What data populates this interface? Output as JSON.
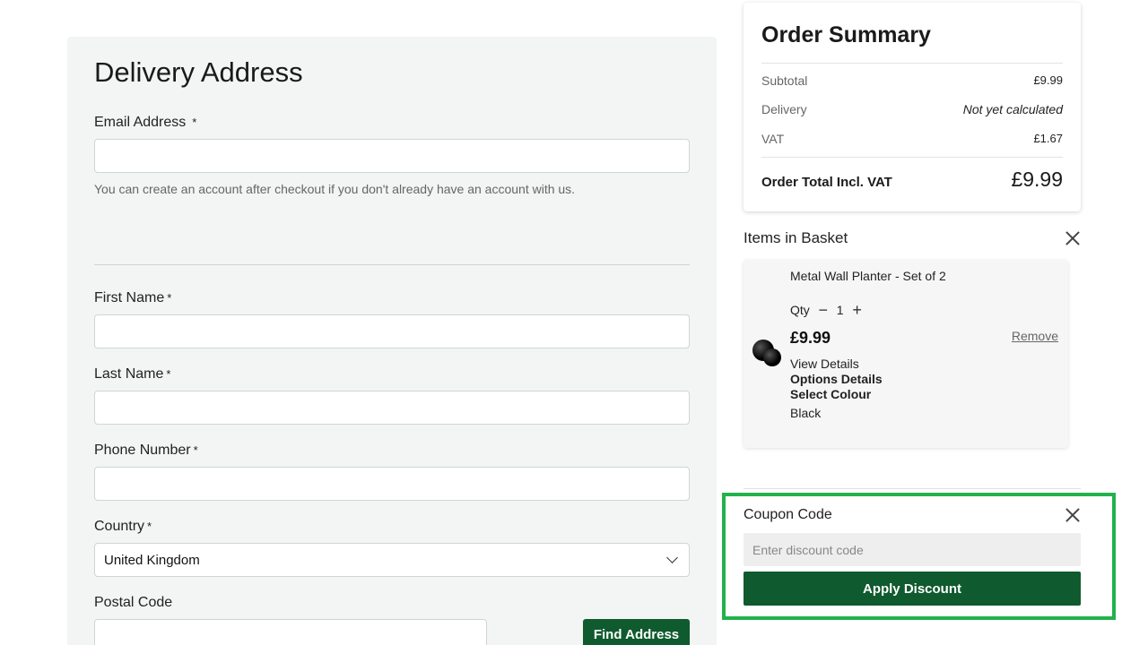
{
  "delivery": {
    "title": "Delivery Address",
    "required_marker": "*",
    "email_label": "Email Address",
    "email_value": "",
    "email_help": "You can create an account after checkout if you don't already have an account with us.",
    "first_name_label": "First Name",
    "last_name_label": "Last Name",
    "phone_label": "Phone Number",
    "country_label": "Country",
    "country_value": "United Kingdom",
    "postal_label": "Postal Code",
    "find_address_label": "Find Address"
  },
  "summary": {
    "title": "Order Summary",
    "rows": [
      {
        "label": "Subtotal",
        "value": "£9.99"
      },
      {
        "label": "Delivery",
        "value": "Not yet calculated"
      },
      {
        "label": "VAT",
        "value": "£1.67"
      }
    ],
    "total_label": "Order Total Incl. VAT",
    "total_value": "£9.99"
  },
  "basket": {
    "title": "Items in Basket",
    "item": {
      "name": "Metal Wall Planter - Set of 2",
      "qty_label": "Qty",
      "qty_minus": "−",
      "qty_value": "1",
      "qty_plus": "+",
      "price": "£9.99",
      "remove_label": "Remove",
      "view_details": "View Details",
      "options_details": "Options Details",
      "select_colour": "Select Colour",
      "colour": "Black"
    }
  },
  "coupon": {
    "title": "Coupon Code",
    "placeholder": "Enter discount code",
    "apply_label": "Apply Discount"
  },
  "colors": {
    "brand_green": "#0f5a2e",
    "highlight_green": "#22b24c",
    "panel_bg": "#f2f5f3"
  },
  "icons": {
    "close": "close-icon",
    "chevron": "chevron-down-icon",
    "minus": "minus-icon",
    "plus": "plus-icon"
  }
}
